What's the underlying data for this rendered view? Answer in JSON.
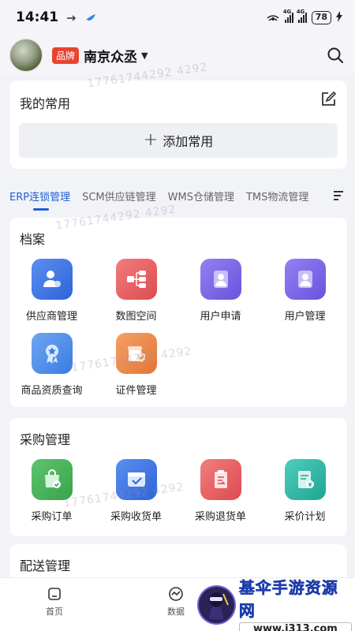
{
  "status_bar": {
    "time": "14:41",
    "battery": "78",
    "net1": "4G",
    "net2": "4G"
  },
  "header": {
    "brand_tag": "品牌",
    "company": "南京众丞"
  },
  "favorites": {
    "title": "我的常用",
    "add_label": "添加常用"
  },
  "tabs": [
    {
      "label": "ERP连锁管理",
      "active": true
    },
    {
      "label": "SCM供应链管理",
      "active": false
    },
    {
      "label": "WMS仓储管理",
      "active": false
    },
    {
      "label": "TMS物流管理",
      "active": false
    }
  ],
  "archive": {
    "title": "档案",
    "items": [
      {
        "label": "供应商管理",
        "icon": "supplier-icon",
        "color": "#3d73e8"
      },
      {
        "label": "数图空间",
        "icon": "mindmap-icon",
        "color": "#e9585c"
      },
      {
        "label": "用户申请",
        "icon": "user-apply-icon",
        "color": "#7a63e6"
      },
      {
        "label": "用户管理",
        "icon": "user-manage-icon",
        "color": "#7a63e6"
      },
      {
        "label": "商品资质查询",
        "icon": "certificate-badge-icon",
        "color": "#4a8ce8"
      },
      {
        "label": "证件管理",
        "icon": "shop-shield-icon",
        "color": "#ee8a4a"
      }
    ]
  },
  "purchase": {
    "title": "采购管理",
    "items": [
      {
        "label": "采购订单",
        "icon": "shopping-bag-icon",
        "color": "#46b55a"
      },
      {
        "label": "采购收货单",
        "icon": "receive-box-icon",
        "color": "#3d73e8"
      },
      {
        "label": "采购退货单",
        "icon": "return-doc-icon",
        "color": "#e9585c"
      },
      {
        "label": "采价计划",
        "icon": "price-plan-icon",
        "color": "#2ebaa8"
      }
    ]
  },
  "delivery": {
    "title": "配送管理"
  },
  "watermark": "17761744292 4292",
  "bottom_nav": {
    "home": "首页",
    "data": "数据"
  },
  "site_logo": {
    "name": "基伞手游资源网",
    "url": "www.j313.com"
  },
  "colors": {
    "accent": "#1f5fd6",
    "brand_tag": "#e8452f",
    "page_bg": "#f2f3f7"
  }
}
